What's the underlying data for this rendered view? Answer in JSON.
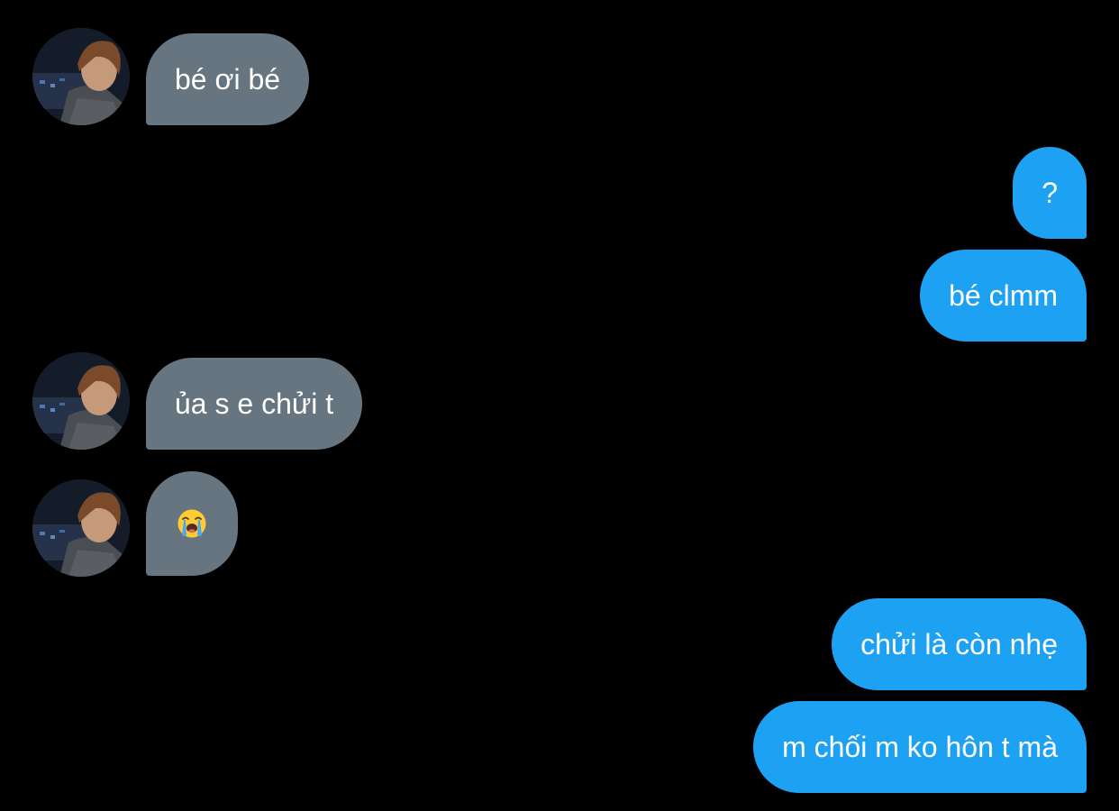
{
  "colors": {
    "background": "#000000",
    "incoming_bubble": "#66757f",
    "outgoing_bubble": "#1da1f2",
    "text": "#ffffff"
  },
  "contact": {
    "avatar_icon": "user-avatar-photo"
  },
  "messages": [
    {
      "direction": "incoming",
      "text": "bé ơi bé",
      "has_avatar": true
    },
    {
      "direction": "outgoing",
      "text": "?"
    },
    {
      "direction": "outgoing",
      "text": "bé clmm"
    },
    {
      "direction": "incoming",
      "text": "ủa s e chửi t",
      "has_avatar": true
    },
    {
      "direction": "incoming",
      "emoji": "loudly-crying-face-emoji",
      "has_avatar": true
    },
    {
      "direction": "outgoing",
      "text": "chửi là còn nhẹ"
    },
    {
      "direction": "outgoing",
      "text": "m chối m ko hôn t mà"
    }
  ]
}
